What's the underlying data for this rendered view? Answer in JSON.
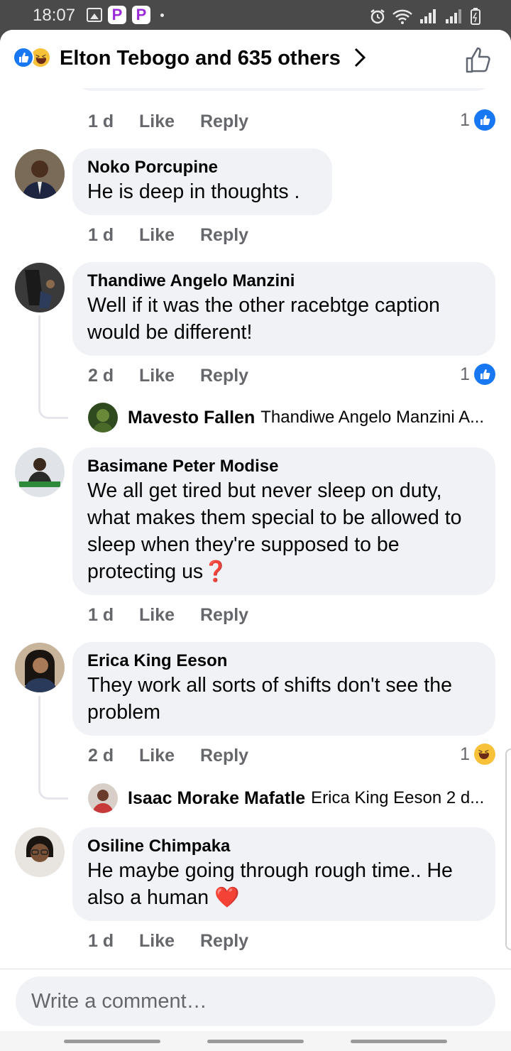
{
  "status_bar": {
    "time": "18:07"
  },
  "header": {
    "title": "Elton Tebogo and 635 others"
  },
  "top_partial": {
    "time": "1 d",
    "like": "Like",
    "reply": "Reply",
    "reaction_count": "1"
  },
  "comments": [
    {
      "name": "Noko Porcupine",
      "text": "He is deep in thoughts .",
      "time": "1 d",
      "like": "Like",
      "reply": "Reply"
    },
    {
      "name": "Thandiwe Angelo Manzini",
      "text": "Well if it was the other racebtge caption would be different!",
      "time": "2 d",
      "like": "Like",
      "reply": "Reply",
      "reaction_count": "1",
      "reply_preview": {
        "name": "Mavesto Fallen",
        "text": "Thandiwe Angelo Manzini A..."
      }
    },
    {
      "name": "Basimane Peter Modise",
      "text": "We all get tired but never sleep on duty, what makes them special to be allowed to sleep when they're supposed to be protecting us",
      "emoji": "❓",
      "time": "1 d",
      "like": "Like",
      "reply": "Reply"
    },
    {
      "name": "Erica King Eeson",
      "text": "They work all sorts of shifts don't see the problem",
      "time": "2 d",
      "like": "Like",
      "reply": "Reply",
      "reaction_count": "1",
      "reply_preview": {
        "name": "Isaac Morake Mafatle",
        "text": "Erica King Eeson  2 d..."
      }
    },
    {
      "name": "Osiline Chimpaka",
      "text": "He maybe going through  rough time.. He also a human",
      "emoji": "❤️",
      "time": "1 d",
      "like": "Like",
      "reply": "Reply"
    }
  ],
  "composer": {
    "placeholder": "Write a comment…"
  },
  "colors": {
    "brand_blue": "#1877f2",
    "bubble_bg": "#f0f2f5",
    "meta_gray": "#65676b",
    "status_bar_bg": "#4a4a4a"
  }
}
